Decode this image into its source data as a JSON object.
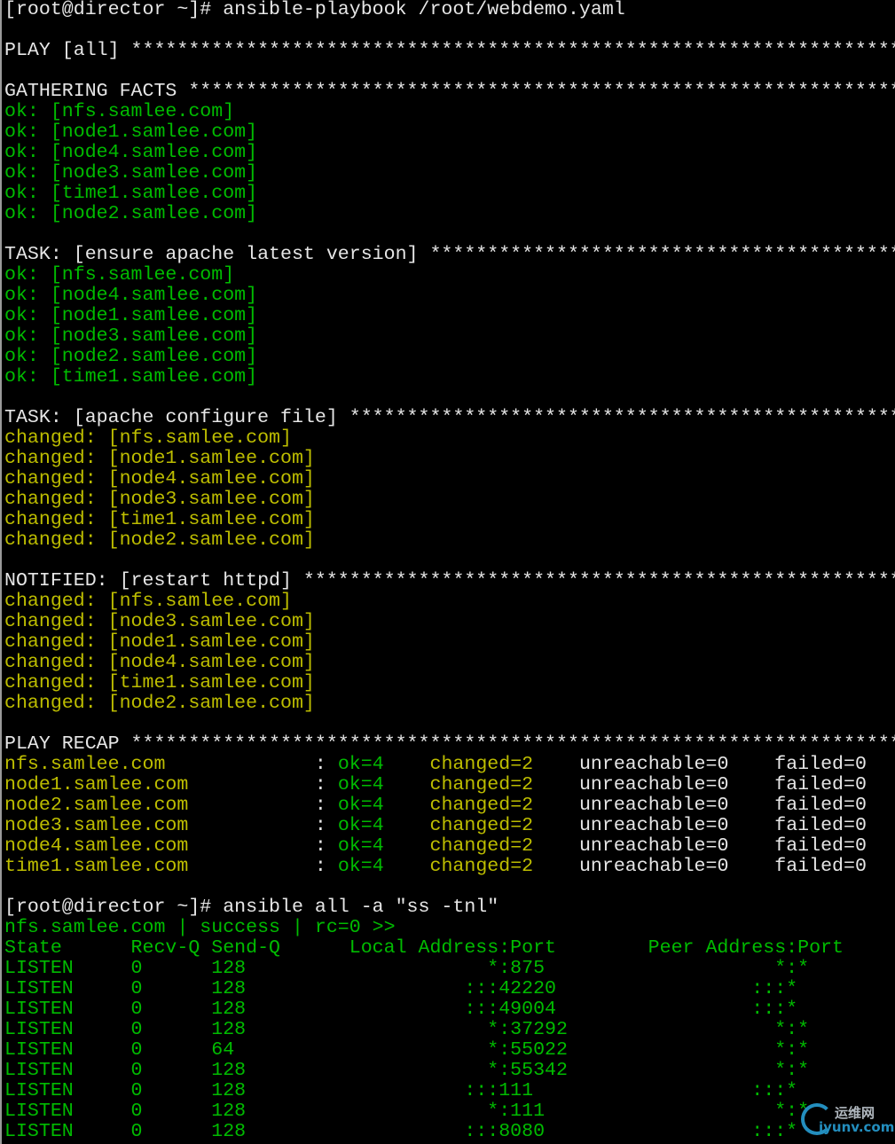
{
  "colors": {
    "w": "#e6e6e6",
    "g": "#00bb00",
    "y": "#bdbd00"
  },
  "watermark": {
    "line1": "运维网",
    "line2": "iyunv.com"
  },
  "lines": [
    [
      [
        "[root@director ~]# ansible-playbook /root/webdemo.yaml",
        "w"
      ]
    ],
    [],
    [
      [
        "PLAY [all] *******************************************************************",
        "w"
      ]
    ],
    [],
    [
      [
        "GATHERING FACTS **************************************************************",
        "w"
      ]
    ],
    [
      [
        "ok: [nfs.samlee.com]",
        "g"
      ]
    ],
    [
      [
        "ok: [node1.samlee.com]",
        "g"
      ]
    ],
    [
      [
        "ok: [node4.samlee.com]",
        "g"
      ]
    ],
    [
      [
        "ok: [node3.samlee.com]",
        "g"
      ]
    ],
    [
      [
        "ok: [time1.samlee.com]",
        "g"
      ]
    ],
    [
      [
        "ok: [node2.samlee.com]",
        "g"
      ]
    ],
    [],
    [
      [
        "TASK: [ensure apache latest version] *****************************************",
        "w"
      ]
    ],
    [
      [
        "ok: [nfs.samlee.com]",
        "g"
      ]
    ],
    [
      [
        "ok: [node4.samlee.com]",
        "g"
      ]
    ],
    [
      [
        "ok: [node1.samlee.com]",
        "g"
      ]
    ],
    [
      [
        "ok: [node3.samlee.com]",
        "g"
      ]
    ],
    [
      [
        "ok: [node2.samlee.com]",
        "g"
      ]
    ],
    [
      [
        "ok: [time1.samlee.com]",
        "g"
      ]
    ],
    [],
    [
      [
        "TASK: [apache configure file] ************************************************",
        "w"
      ]
    ],
    [
      [
        "changed: [nfs.samlee.com]",
        "y"
      ]
    ],
    [
      [
        "changed: [node1.samlee.com]",
        "y"
      ]
    ],
    [
      [
        "changed: [node4.samlee.com]",
        "y"
      ]
    ],
    [
      [
        "changed: [node3.samlee.com]",
        "y"
      ]
    ],
    [
      [
        "changed: [time1.samlee.com]",
        "y"
      ]
    ],
    [
      [
        "changed: [node2.samlee.com]",
        "y"
      ]
    ],
    [],
    [
      [
        "NOTIFIED: [restart httpd] ****************************************************",
        "w"
      ]
    ],
    [
      [
        "changed: [nfs.samlee.com]",
        "y"
      ]
    ],
    [
      [
        "changed: [node3.samlee.com]",
        "y"
      ]
    ],
    [
      [
        "changed: [node1.samlee.com]",
        "y"
      ]
    ],
    [
      [
        "changed: [node4.samlee.com]",
        "y"
      ]
    ],
    [
      [
        "changed: [time1.samlee.com]",
        "y"
      ]
    ],
    [
      [
        "changed: [node2.samlee.com]",
        "y"
      ]
    ],
    [],
    [
      [
        "PLAY RECAP *******************************************************************",
        "w"
      ]
    ],
    [
      [
        "nfs.samlee.com             ",
        "y"
      ],
      [
        ": ",
        "w"
      ],
      [
        "ok=4",
        "g"
      ],
      [
        "    ",
        "w"
      ],
      [
        "changed=2",
        "y"
      ],
      [
        "    unreachable=0    failed=0",
        "w"
      ]
    ],
    [
      [
        "node1.samlee.com           ",
        "y"
      ],
      [
        ": ",
        "w"
      ],
      [
        "ok=4",
        "g"
      ],
      [
        "    ",
        "w"
      ],
      [
        "changed=2",
        "y"
      ],
      [
        "    unreachable=0    failed=0",
        "w"
      ]
    ],
    [
      [
        "node2.samlee.com           ",
        "y"
      ],
      [
        ": ",
        "w"
      ],
      [
        "ok=4",
        "g"
      ],
      [
        "    ",
        "w"
      ],
      [
        "changed=2",
        "y"
      ],
      [
        "    unreachable=0    failed=0",
        "w"
      ]
    ],
    [
      [
        "node3.samlee.com           ",
        "y"
      ],
      [
        ": ",
        "w"
      ],
      [
        "ok=4",
        "g"
      ],
      [
        "    ",
        "w"
      ],
      [
        "changed=2",
        "y"
      ],
      [
        "    unreachable=0    failed=0",
        "w"
      ]
    ],
    [
      [
        "node4.samlee.com           ",
        "y"
      ],
      [
        ": ",
        "w"
      ],
      [
        "ok=4",
        "g"
      ],
      [
        "    ",
        "w"
      ],
      [
        "changed=2",
        "y"
      ],
      [
        "    unreachable=0    failed=0",
        "w"
      ]
    ],
    [
      [
        "time1.samlee.com           ",
        "y"
      ],
      [
        ": ",
        "w"
      ],
      [
        "ok=4",
        "g"
      ],
      [
        "    ",
        "w"
      ],
      [
        "changed=2",
        "y"
      ],
      [
        "    unreachable=0    failed=0",
        "w"
      ]
    ],
    [],
    [
      [
        "[root@director ~]# ansible all -a \"ss -tnl\"",
        "w"
      ]
    ],
    [
      [
        "nfs.samlee.com | success | rc=0 >>",
        "g"
      ]
    ],
    [
      [
        "State      Recv-Q Send-Q      Local Address:Port        Peer Address:Port",
        "g"
      ]
    ],
    [
      [
        "LISTEN     0      128                     *:875                    *:*",
        "g"
      ]
    ],
    [
      [
        "LISTEN     0      128                   :::42220                 :::*",
        "g"
      ]
    ],
    [
      [
        "LISTEN     0      128                   :::49004                 :::*",
        "g"
      ]
    ],
    [
      [
        "LISTEN     0      128                     *:37292                  *:*",
        "g"
      ]
    ],
    [
      [
        "LISTEN     0      64                      *:55022                  *:*",
        "g"
      ]
    ],
    [
      [
        "LISTEN     0      128                     *:55342                  *:*",
        "g"
      ]
    ],
    [
      [
        "LISTEN     0      128                   :::111                   :::*",
        "g"
      ]
    ],
    [
      [
        "LISTEN     0      128                     *:111                    *:*",
        "g"
      ]
    ],
    [
      [
        "LISTEN     0      128                   :::8080                  :::*",
        "g"
      ]
    ]
  ]
}
